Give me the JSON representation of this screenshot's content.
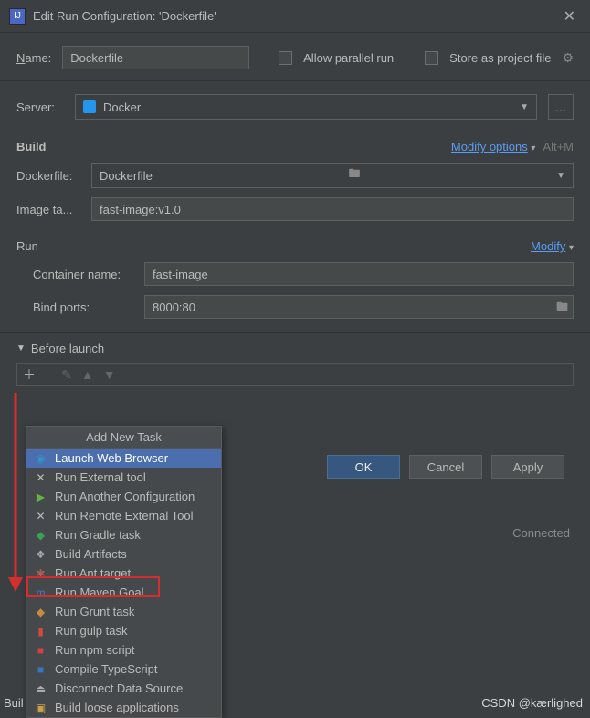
{
  "titlebar": {
    "title": "Edit Run Configuration: 'Dockerfile'"
  },
  "name": {
    "label": "Name:",
    "value": "Dockerfile"
  },
  "allow_parallel": {
    "label": "Allow parallel run"
  },
  "store_as_file": {
    "label": "Store as project file"
  },
  "server": {
    "label": "Server:",
    "value": "Docker"
  },
  "build": {
    "title": "Build",
    "modify": "Modify options",
    "shortcut": "Alt+M",
    "dockerfile_label": "Dockerfile:",
    "dockerfile_value": "Dockerfile",
    "image_tag_label": "Image ta...",
    "image_tag_value": "fast-image:v1.0"
  },
  "run": {
    "title": "Run",
    "modify": "Modify",
    "container_label": "Container name:",
    "container_value": "fast-image",
    "bind_label": "Bind ports:",
    "bind_value": "8000:80"
  },
  "before_launch": {
    "label": "Before launch"
  },
  "popup": {
    "title": "Add New Task",
    "items": [
      {
        "label": "Launch Web Browser",
        "color": "#3592c4",
        "glyph": "◉"
      },
      {
        "label": "Run External tool",
        "color": "#bbb",
        "glyph": "✕"
      },
      {
        "label": "Run Another Configuration",
        "color": "#62b543",
        "glyph": "▶"
      },
      {
        "label": "Run Remote External Tool",
        "color": "#bbb",
        "glyph": "✕"
      },
      {
        "label": "Run Gradle task",
        "color": "#3ea055",
        "glyph": "◆"
      },
      {
        "label": "Build Artifacts",
        "color": "#aaa",
        "glyph": "❖"
      },
      {
        "label": "Run Ant target",
        "color": "#b05c56",
        "glyph": "✱"
      },
      {
        "label": "Run Maven Goal",
        "color": "#3f7dd1",
        "glyph": "m"
      },
      {
        "label": "Run Grunt task",
        "color": "#c88a3f",
        "glyph": "◆"
      },
      {
        "label": "Run gulp task",
        "color": "#d04a3f",
        "glyph": "▮"
      },
      {
        "label": "Run npm script",
        "color": "#c44",
        "glyph": "■"
      },
      {
        "label": "Compile TypeScript",
        "color": "#3178c6",
        "glyph": "■"
      },
      {
        "label": "Disconnect Data Source",
        "color": "#aaa",
        "glyph": "⏏"
      },
      {
        "label": "Build loose applications",
        "color": "#c9a14a",
        "glyph": "▣"
      }
    ]
  },
  "buttons": {
    "ok": "OK",
    "cancel": "Cancel",
    "apply": "Apply"
  },
  "status": {
    "connected": "Connected"
  },
  "footer": {
    "left": "Buil",
    "watermark": "CSDN @kærlighed"
  }
}
